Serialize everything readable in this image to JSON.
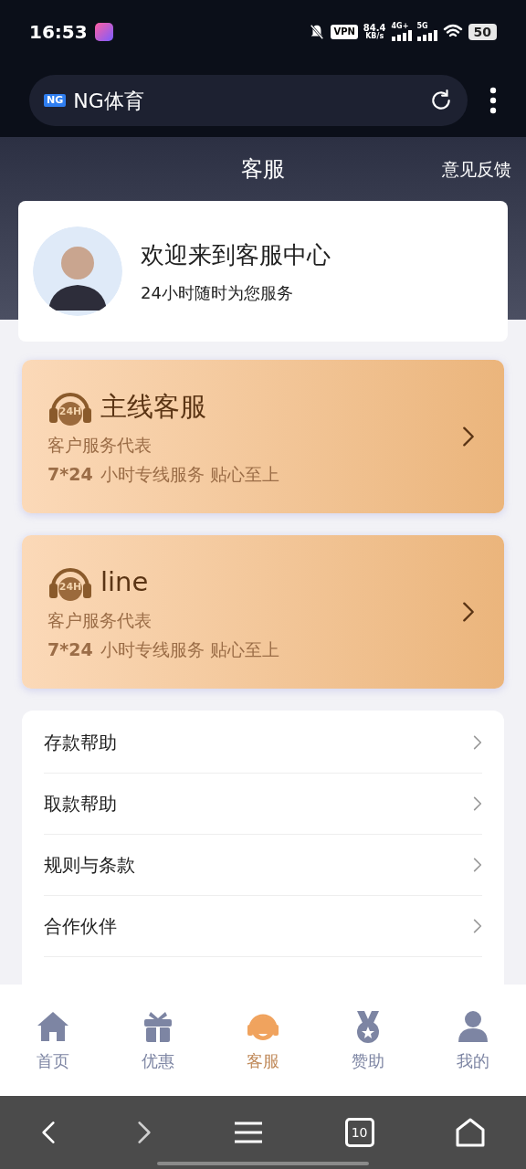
{
  "status_bar": {
    "time": "16:53",
    "vpn": "VPN",
    "speed": "84.4",
    "speed_unit": "KB/s",
    "network_1": "4G+",
    "network_2": "5G",
    "battery": "50"
  },
  "browser": {
    "logo": "NG",
    "title": "NG体育"
  },
  "header": {
    "title": "客服",
    "action": "意见反馈"
  },
  "welcome": {
    "title": "欢迎来到客服中心",
    "subtitle": "24小时随时为您服务"
  },
  "services": [
    {
      "badge": "24H",
      "title": "主线客服",
      "subtitle": "客户服务代表",
      "hours": "7*24",
      "text": "小时专线服务 贴心至上"
    },
    {
      "badge": "24H",
      "title": "line",
      "subtitle": "客户服务代表",
      "hours": "7*24",
      "text": "小时专线服务 贴心至上"
    }
  ],
  "help_items": [
    "存款帮助",
    "取款帮助",
    "规则与条款",
    "合作伙伴"
  ],
  "tabs": [
    {
      "kind": "home",
      "label": "首页",
      "selected": false
    },
    {
      "kind": "gift",
      "label": "优惠",
      "selected": false
    },
    {
      "kind": "support",
      "label": "客服",
      "selected": true
    },
    {
      "kind": "medal",
      "label": "赞助",
      "selected": false
    },
    {
      "kind": "user",
      "label": "我的",
      "selected": false
    }
  ],
  "browser_nav": {
    "tab_count": "10"
  }
}
